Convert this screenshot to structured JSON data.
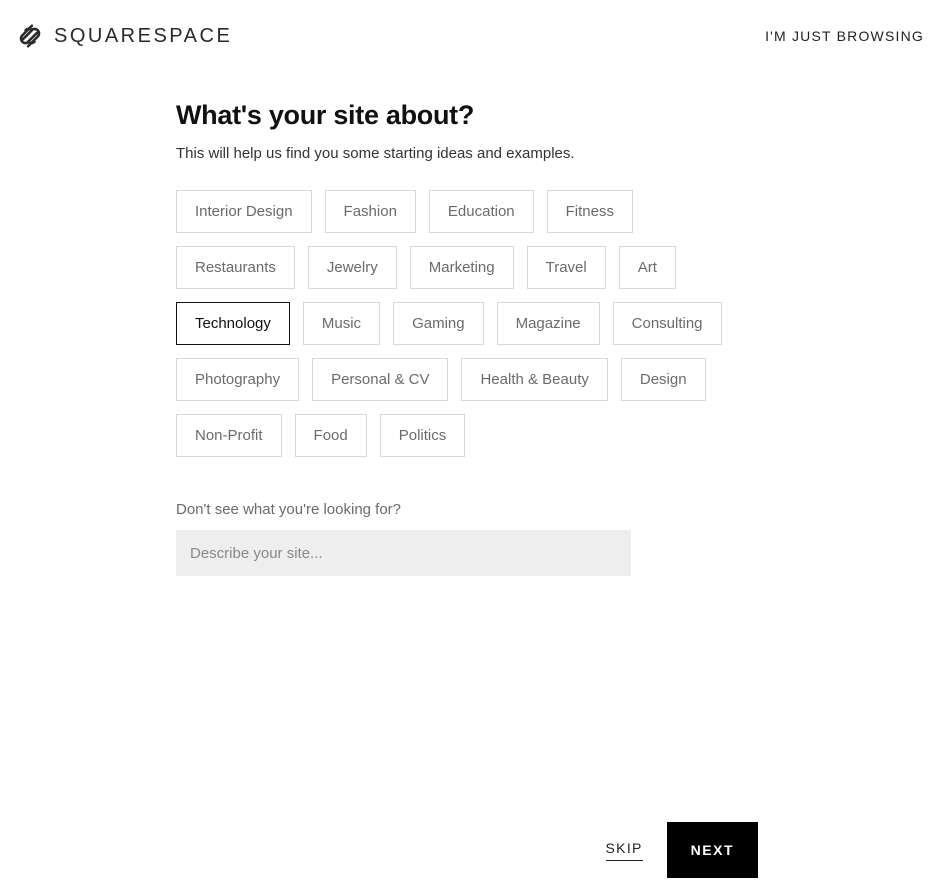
{
  "header": {
    "brand": "SQUARESPACE",
    "browsing": "I'M JUST BROWSING"
  },
  "main": {
    "heading": "What's your site about?",
    "subheading": "This will help us find you some starting ideas and examples.",
    "categories": [
      {
        "label": "Interior Design",
        "selected": false
      },
      {
        "label": "Fashion",
        "selected": false
      },
      {
        "label": "Education",
        "selected": false
      },
      {
        "label": "Fitness",
        "selected": false
      },
      {
        "label": "Restaurants",
        "selected": false
      },
      {
        "label": "Jewelry",
        "selected": false
      },
      {
        "label": "Marketing",
        "selected": false
      },
      {
        "label": "Travel",
        "selected": false
      },
      {
        "label": "Art",
        "selected": false
      },
      {
        "label": "Technology",
        "selected": true
      },
      {
        "label": "Music",
        "selected": false
      },
      {
        "label": "Gaming",
        "selected": false
      },
      {
        "label": "Magazine",
        "selected": false
      },
      {
        "label": "Consulting",
        "selected": false
      },
      {
        "label": "Photography",
        "selected": false
      },
      {
        "label": "Personal & CV",
        "selected": false
      },
      {
        "label": "Health & Beauty",
        "selected": false
      },
      {
        "label": "Design",
        "selected": false
      },
      {
        "label": "Non-Profit",
        "selected": false
      },
      {
        "label": "Food",
        "selected": false
      },
      {
        "label": "Politics",
        "selected": false
      }
    ],
    "search_label": "Don't see what you're looking for?",
    "search_placeholder": "Describe your site..."
  },
  "footer": {
    "skip": "SKIP",
    "next": "NEXT"
  }
}
